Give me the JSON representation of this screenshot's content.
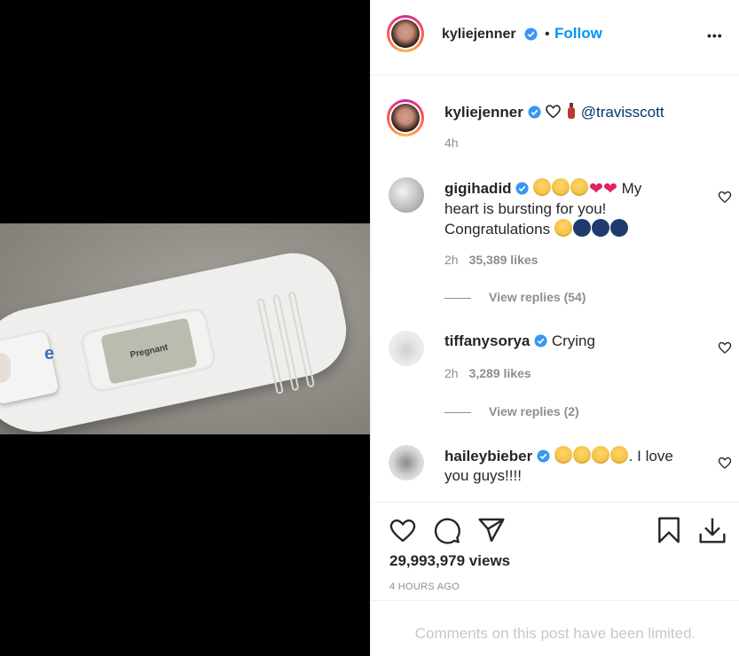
{
  "media": {
    "screen_text": "Pregnant",
    "cap_text": "e"
  },
  "header": {
    "username": "kyliejenner",
    "separator": "•",
    "follow_label": "Follow",
    "more_label": "•••"
  },
  "caption": {
    "username": "kyliejenner",
    "mention": "@travisscott",
    "time": "4h"
  },
  "comments": [
    {
      "username": "gigihadid",
      "text_1": "My",
      "text_2": "heart is bursting for you!",
      "text_3": "Congratulations",
      "time": "2h",
      "likes": "35,389 likes",
      "replies": "View replies (54)"
    },
    {
      "username": "tiffanysorya",
      "text": "Crying",
      "time": "2h",
      "likes": "3,289 likes",
      "replies": "View replies (2)"
    },
    {
      "username": "haileybieber",
      "text_1": ". I",
      "text_2": "love you guys!!!!"
    }
  ],
  "actions": {
    "views": "29,993,979 views",
    "time_ago": "4 HOURS AGO"
  },
  "footer": {
    "limited_text": "Comments on this post have been limited."
  },
  "colors": {
    "accent": "#0095f6",
    "text": "#262626",
    "muted": "#8e8e8e",
    "verified": "#3897f0"
  }
}
